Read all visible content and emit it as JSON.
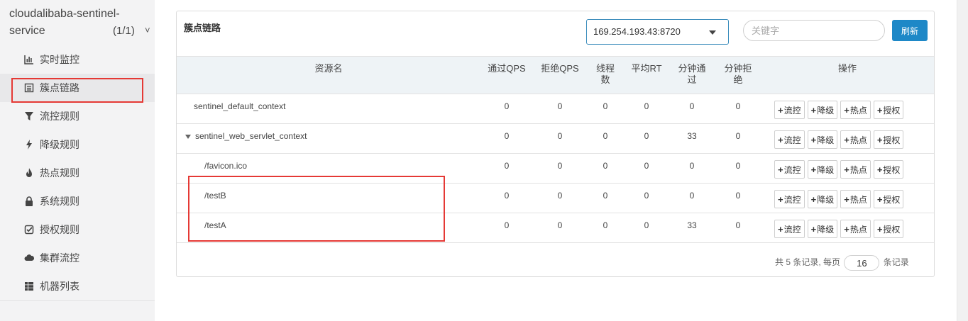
{
  "app": {
    "name": "cloudalibaba-sentinel-service",
    "count": "(1/1)",
    "chevron": "˅"
  },
  "sidebar": {
    "items": [
      {
        "label": "实时监控",
        "icon": "bar-chart-icon"
      },
      {
        "label": "簇点链路",
        "icon": "list-icon",
        "active": true
      },
      {
        "label": "流控规则",
        "icon": "filter-icon"
      },
      {
        "label": "降级规则",
        "icon": "flash-icon"
      },
      {
        "label": "热点规则",
        "icon": "fire-icon"
      },
      {
        "label": "系统规则",
        "icon": "lock-icon"
      },
      {
        "label": "授权规则",
        "icon": "check-square-icon"
      },
      {
        "label": "集群流控",
        "icon": "cloud-icon"
      },
      {
        "label": "机器列表",
        "icon": "th-list-icon"
      }
    ]
  },
  "panel": {
    "title": "簇点链路",
    "machine": "169.254.193.43:8720",
    "search_placeholder": "关键字",
    "refresh_label": "刷新"
  },
  "table": {
    "headers": {
      "name": "资源名",
      "pass_qps": "通过QPS",
      "block_qps": "拒绝QPS",
      "threads_1": "线程",
      "threads_2": "数",
      "avg_rt": "平均RT",
      "min_pass_1": "分钟通",
      "min_pass_2": "过",
      "min_block_1": "分钟拒",
      "min_block_2": "绝",
      "ops": "操作"
    },
    "rows": [
      {
        "name": "sentinel_default_context",
        "pass_qps": "0",
        "block_qps": "0",
        "threads": "0",
        "avg_rt": "0",
        "min_pass": "0",
        "min_block": "0"
      },
      {
        "name": "sentinel_web_servlet_context",
        "pass_qps": "0",
        "block_qps": "0",
        "threads": "0",
        "avg_rt": "0",
        "min_pass": "33",
        "min_block": "0",
        "expanded": true
      },
      {
        "name": "/favicon.ico",
        "pass_qps": "0",
        "block_qps": "0",
        "threads": "0",
        "avg_rt": "0",
        "min_pass": "0",
        "min_block": "0"
      },
      {
        "name": "/testB",
        "pass_qps": "0",
        "block_qps": "0",
        "threads": "0",
        "avg_rt": "0",
        "min_pass": "0",
        "min_block": "0"
      },
      {
        "name": "/testA",
        "pass_qps": "0",
        "block_qps": "0",
        "threads": "0",
        "avg_rt": "0",
        "min_pass": "33",
        "min_block": "0"
      }
    ],
    "op_buttons": {
      "flow": "流控",
      "degrade": "降级",
      "hot": "热点",
      "auth": "授权"
    }
  },
  "pager": {
    "prefix": "共 5 条记录, 每页",
    "page_size": "16",
    "suffix": "条记录"
  },
  "colors": {
    "accent": "#1e88c7",
    "annotation": "#e53935",
    "header_bg": "#eef3f6"
  }
}
